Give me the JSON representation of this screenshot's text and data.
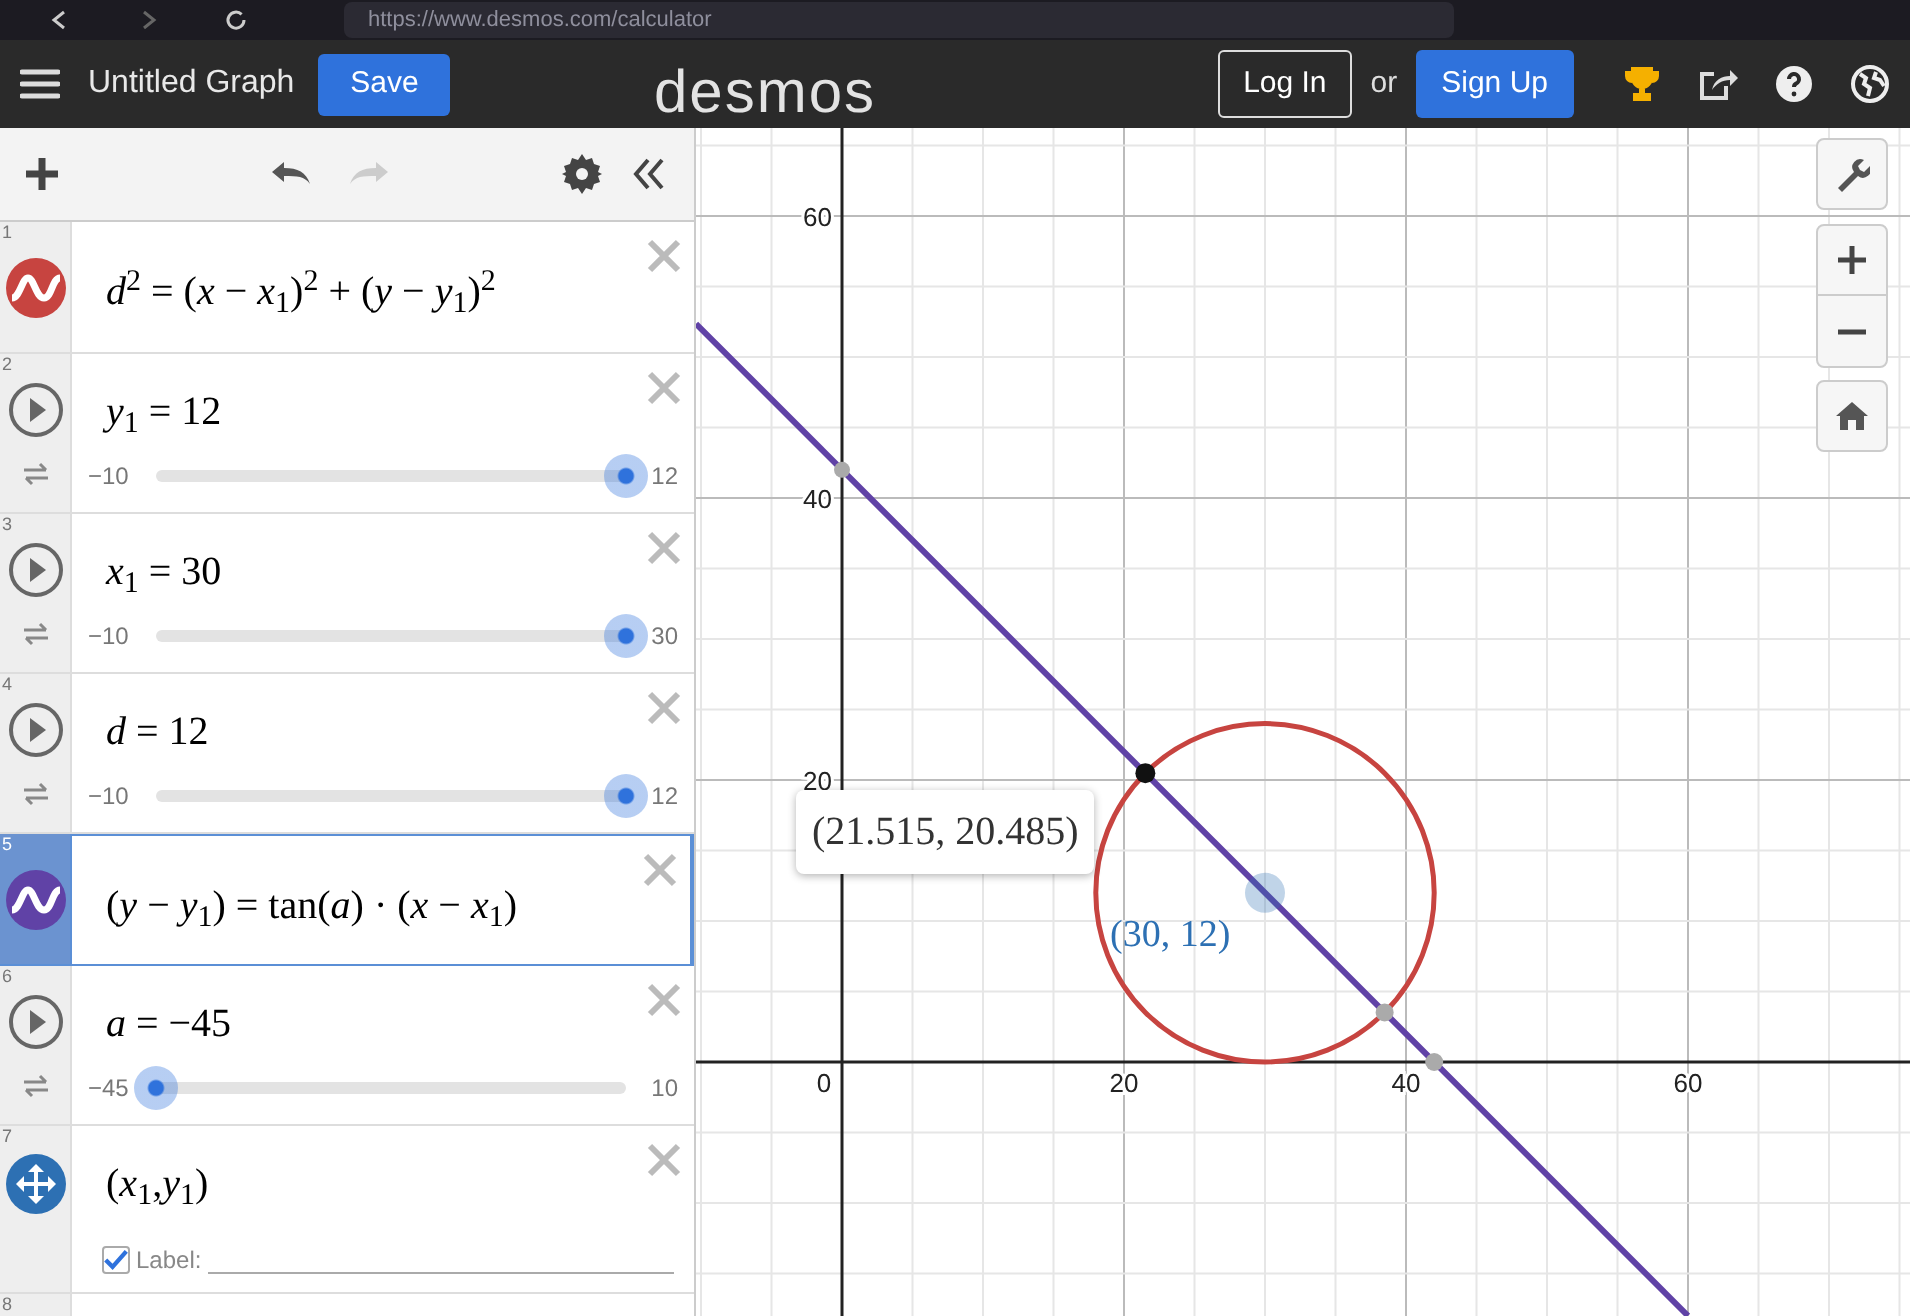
{
  "browser": {
    "url": "https://www.desmos.com/calculator"
  },
  "header": {
    "title": "Untitled Graph",
    "save": "Save",
    "logo": "desmos",
    "login": "Log In",
    "or": "or",
    "signup": "Sign Up"
  },
  "expressions": [
    {
      "number": "1",
      "kind": "equation",
      "color": "#c74440",
      "selected": false,
      "latex": "*d*$^{2}$ = (*x* − *x*$_{1}$)$^{2}$ + (*y* − *y*$_{1}$)$^{2}$"
    },
    {
      "number": "2",
      "kind": "slider",
      "selected": false,
      "latex": "*y*$_{1}$ = 12",
      "min": "−10",
      "max": "12",
      "level": 1
    },
    {
      "number": "3",
      "kind": "slider",
      "selected": false,
      "latex": "*x*$_{1}$ = 30",
      "min": "−10",
      "max": "30",
      "level": 1
    },
    {
      "number": "4",
      "kind": "slider",
      "selected": false,
      "latex": "*d* = 12",
      "min": "−10",
      "max": "12",
      "level": 1
    },
    {
      "number": "5",
      "kind": "equation",
      "color": "#6042a6",
      "selected": true,
      "latex": "(*y* − *y*$_{1}$) = tan(*a*) · (*x* − *x*$_{1}$)"
    },
    {
      "number": "6",
      "kind": "slider",
      "selected": false,
      "latex": "*a* = −45",
      "min": "−45",
      "max": "10",
      "level": 0
    },
    {
      "number": "7",
      "kind": "point",
      "selected": false,
      "latex": "(*x*$_{1}$,*y*$_{1}$)",
      "label_checked": true,
      "label_text": "Label:"
    },
    {
      "number": "8",
      "kind": "empty",
      "selected": false
    }
  ],
  "graph": {
    "x_ticks": [
      "0",
      "20",
      "40",
      "60"
    ],
    "y_ticks": [
      "60",
      "40",
      "20"
    ],
    "point_labels": [
      {
        "kind": "tooltip",
        "text": "(21.515, 20.485)"
      },
      {
        "kind": "point",
        "text": "(30, 12)"
      }
    ]
  }
}
